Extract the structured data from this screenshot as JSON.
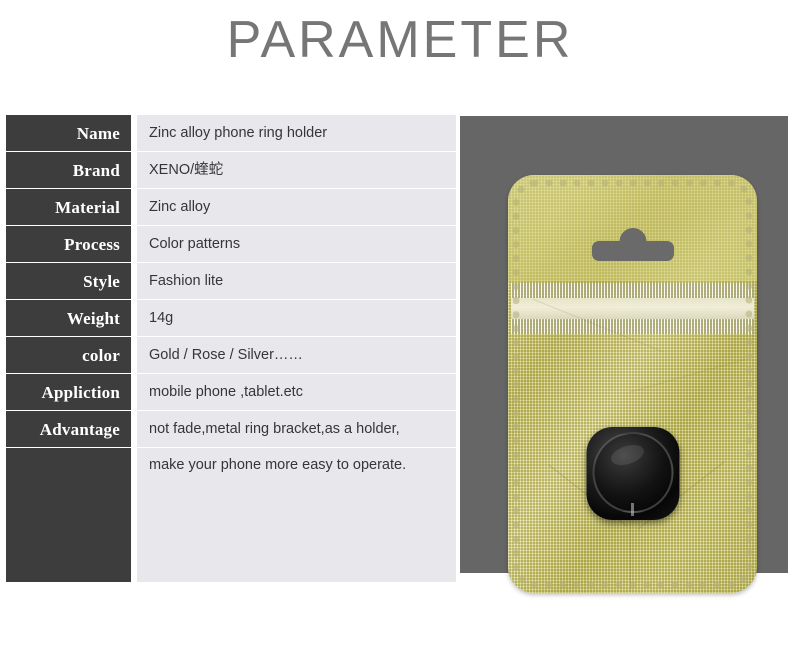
{
  "page": {
    "title": "PARAMETER"
  },
  "colors": {
    "title_gray": "#767676",
    "label_cell_dark": "#3d3d3d",
    "value_cell_light": "#e7e7ec",
    "photo_panel_gray": "#666666",
    "pouch_gold": "#d6d48a",
    "ring_black": "#121212",
    "page_background": "#ffffff"
  },
  "spec_table": {
    "rows": [
      {
        "label": "Name",
        "value": "Zinc alloy phone ring holder"
      },
      {
        "label": "Brand",
        "value": "XENO/蝰蛇"
      },
      {
        "label": "Material",
        "value": "Zinc alloy"
      },
      {
        "label": "Process",
        "value": "Color patterns"
      },
      {
        "label": "Style",
        "value": "Fashion lite"
      },
      {
        "label": "Weight",
        "value": "14g"
      },
      {
        "label": "color",
        "value": "Gold / Rose / Silver……"
      },
      {
        "label": "Appliction",
        "value": "mobile phone ,tablet.etc"
      },
      {
        "label": "Advantage",
        "value": "not fade,metal ring bracket,as a holder,"
      },
      {
        "label": "",
        "value": "make your phone more easy to operate."
      }
    ]
  },
  "product_photo": {
    "alt": "gold foil zip-lock pouch containing a black phone ring holder",
    "package_type": "zip-lock foil pouch",
    "hang_slot": "euro-hang-slot",
    "product": "phone ring holder"
  }
}
